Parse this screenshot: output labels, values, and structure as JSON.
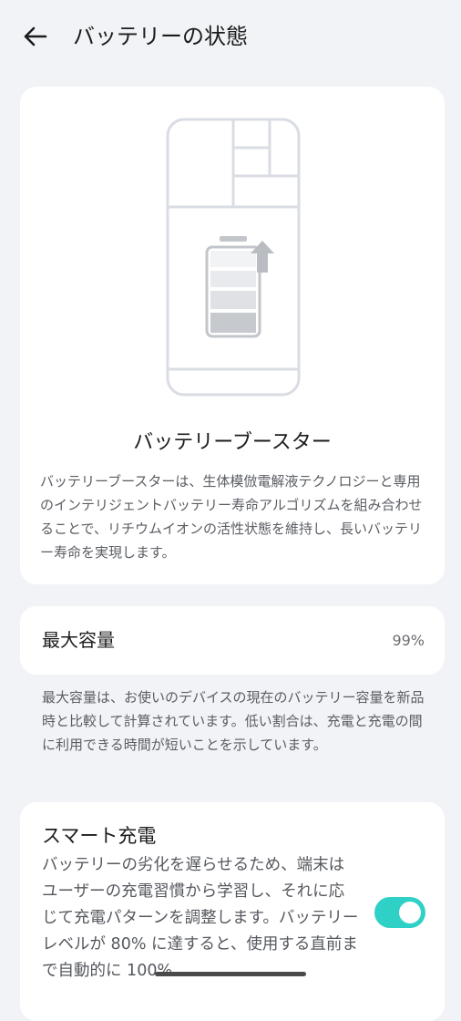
{
  "header": {
    "title": "バッテリーの状態"
  },
  "booster": {
    "title": "バッテリーブースター",
    "description": "バッテリーブースターは、生体模倣電解液テクノロジーと専用のインテリジェントバッテリー寿命アルゴリズムを組み合わせることで、リチウムイオンの活性状態を維持し、長いバッテリー寿命を実現します。"
  },
  "capacity": {
    "label": "最大容量",
    "value": "99%",
    "description": "最大容量は、お使いのデバイスの現在のバッテリー容量を新品時と比較して計算されています。低い割合は、充電と充電の間に利用できる時間が短いことを示しています。"
  },
  "smart_charging": {
    "title": "スマート充電",
    "description": "バッテリーの劣化を遅らせるため、端末はユーザーの充電習慣から学習し、それに応じて充電パターンを調整します。バッテリーレベルが 80% に達すると、使用する直前まで自動的に 100%",
    "enabled": true
  },
  "colors": {
    "background": "#f1f3f6",
    "card": "#ffffff",
    "accent": "#2fd0c6",
    "illustration": "#d9dde3"
  },
  "icons": {
    "back": "arrow-left-icon",
    "booster": "battery-boost-icon"
  }
}
